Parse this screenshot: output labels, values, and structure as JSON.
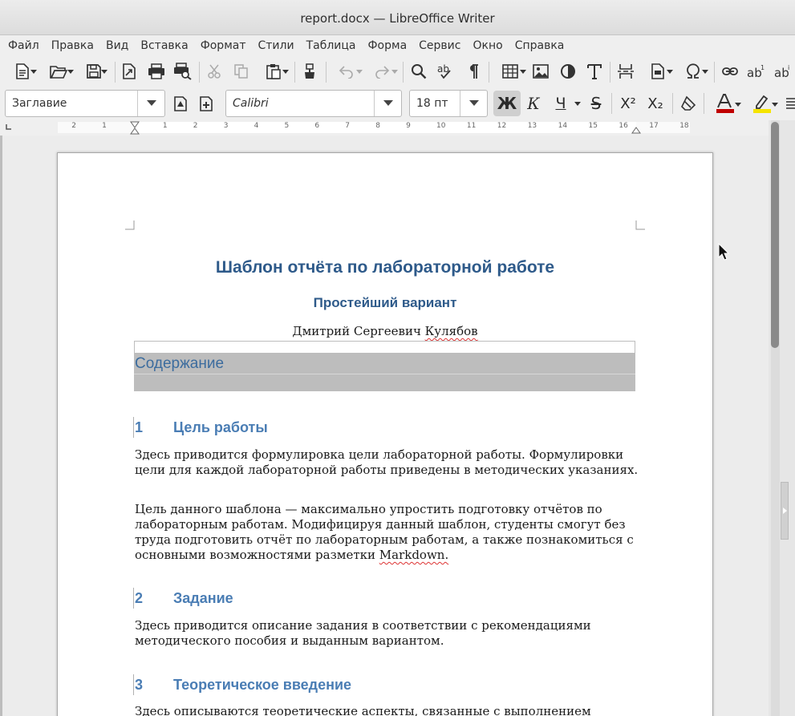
{
  "window": {
    "title": "report.docx — LibreOffice Writer"
  },
  "menu": [
    "Файл",
    "Правка",
    "Вид",
    "Вставка",
    "Формат",
    "Стили",
    "Таблица",
    "Форма",
    "Сервис",
    "Окно",
    "Справка"
  ],
  "toolbar": {
    "paragraph_style": "Заглавие",
    "font_name": "Calibri",
    "font_size": "18 пт",
    "bold_glyph": "Ж",
    "italic_glyph": "К",
    "underline_glyph": "Ч",
    "strike_glyph": "S",
    "superscript_glyph": "X²",
    "subscript_glyph": "X₂",
    "font_color": "#c00000",
    "highlight_color": "#f5e400"
  },
  "ruler": {
    "numbers": [
      "2",
      "1",
      "1",
      "2",
      "3",
      "4",
      "5",
      "6",
      "7",
      "8",
      "9",
      "10",
      "11",
      "12",
      "13",
      "14",
      "15",
      "16",
      "17",
      "18"
    ]
  },
  "document": {
    "title": "Шаблон отчёта по лабораторной работе",
    "subtitle": "Простейший вариант",
    "author_first": "Дмитрий Сергеевич ",
    "author_last": "Кулябов",
    "toc_title": "Содержание",
    "sections": [
      {
        "number": "1",
        "heading": "Цель работы",
        "paragraphs": [
          "Здесь приводится формулировка цели лабораторной работы. Формулировки цели для каждой лабораторной работы приведены в методических указаниях.",
          "Цель данного шаблона — максимально упростить подготовку отчётов по лабораторным работам. Модифицируя данный шаблон, студенты смогут без труда подготовить отчёт по лабораторным работам, а также познакомиться с основными возможностями разметки "
        ],
        "last_word": "Markdown."
      },
      {
        "number": "2",
        "heading": "Задание",
        "paragraphs": [
          "Здесь приводится описание задания в соответствии с рекомендациями методического пособия и выданным вариантом."
        ]
      },
      {
        "number": "3",
        "heading": "Теоретическое введение",
        "paragraphs": [
          "Здесь описываются теоретические аспекты, связанные с выполнением"
        ]
      }
    ]
  }
}
